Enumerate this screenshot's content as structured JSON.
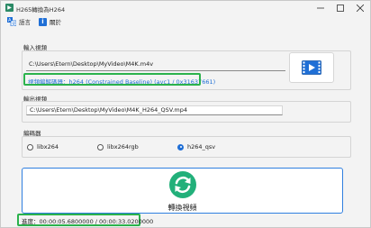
{
  "window": {
    "title": "H265轉換為H264",
    "controls": [
      "minimize",
      "maximize",
      "close"
    ]
  },
  "menu": {
    "language_label": "語言",
    "about_label": "關於"
  },
  "input_section": {
    "label": "輸入視頻",
    "path": "C:\\Users\\Etern\\Desktop\\MyVideo\\M4K.m4v",
    "codec_info": "視頻編解碼器：h264 (Constrained Baseline) (avc1 / 0x31637661)"
  },
  "output_section": {
    "label": "輸出視頻",
    "path": "C:\\Users\\Etern\\Desktop\\MyVideo\\M4K_H264_QSV.mp4"
  },
  "encoder_section": {
    "label": "編碼器",
    "options": [
      {
        "label": "libx264",
        "checked": false
      },
      {
        "label": "libx264rgb",
        "checked": false
      },
      {
        "label": "h264_qsv",
        "checked": true
      }
    ]
  },
  "convert_button": {
    "label": "轉換視頻"
  },
  "progress": {
    "text": "進度：00:00:05.6800000 / 00:00:33.0200000"
  },
  "colors": {
    "accent": "#1f6fd6",
    "highlight_box": "#2bb24c",
    "convert_icon": "#22b07a"
  },
  "icons": {
    "app": "app-icon",
    "language": "language-icon",
    "about": "info-icon",
    "browse_video": "video-file-icon",
    "convert": "refresh-icon"
  }
}
